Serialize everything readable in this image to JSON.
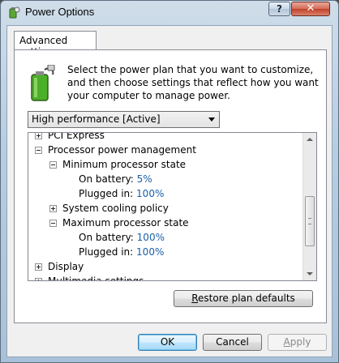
{
  "window": {
    "title": "Power Options",
    "help_glyph": "?",
    "close_glyph": "✕"
  },
  "tab": {
    "label": "Advanced settings"
  },
  "intro": {
    "text": "Select the power plan that you want to customize, and then choose settings that reflect how you want your computer to manage power."
  },
  "plan_select": {
    "value": "High performance [Active]"
  },
  "tree": {
    "items": [
      {
        "label": "PCI Express",
        "state": "collapsed"
      },
      {
        "label": "Processor power management",
        "state": "expanded"
      },
      {
        "label": "Minimum processor state",
        "state": "expanded"
      },
      {
        "label": "On battery:",
        "value": "5%"
      },
      {
        "label": "Plugged in:",
        "value": "100%"
      },
      {
        "label": "System cooling policy",
        "state": "collapsed"
      },
      {
        "label": "Maximum processor state",
        "state": "expanded"
      },
      {
        "label": "On battery:",
        "value": "100%"
      },
      {
        "label": "Plugged in:",
        "value": "100%"
      },
      {
        "label": "Display",
        "state": "collapsed"
      },
      {
        "label": "Multimedia settings",
        "state": "collapsed"
      }
    ]
  },
  "buttons": {
    "restore": {
      "underline": "R",
      "rest": "estore plan defaults"
    },
    "ok": "OK",
    "cancel": "Cancel",
    "apply": {
      "underline": "A",
      "rest": "pply"
    }
  },
  "colors": {
    "value_link": "#1a5fa8",
    "title_bar": "#b8cde0",
    "close_button": "#c0402a"
  }
}
